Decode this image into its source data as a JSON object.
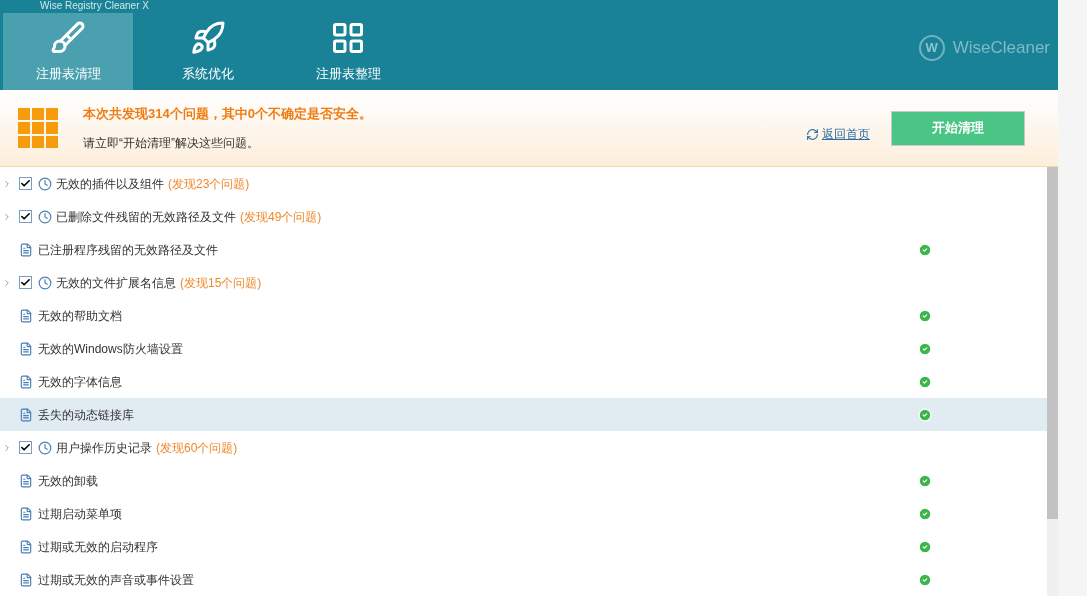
{
  "window": {
    "title": "Wise Registry Cleaner X"
  },
  "tabs": [
    {
      "label": "注册表清理",
      "kind": "broom",
      "selected": true
    },
    {
      "label": "系统优化",
      "kind": "rocket",
      "selected": false
    },
    {
      "label": "注册表整理",
      "kind": "blocks",
      "selected": false
    }
  ],
  "brand_mark": "W",
  "brand": "WiseCleaner",
  "summary": {
    "headline": "本次共发现314个问题，其中0个不确定是否安全。",
    "message": "请立即“开始清理”解决这些问题。",
    "link": "返回首页",
    "button": "开始清理"
  },
  "rows": [
    {
      "kind": "group",
      "label": "无效的插件以及组件",
      "count": "(发现23个问题)",
      "checked": true,
      "selected": false
    },
    {
      "kind": "group",
      "label": "已删除文件残留的无效路径及文件",
      "count": "(发现49个问题)",
      "checked": true,
      "selected": false
    },
    {
      "kind": "item",
      "label": "已注册程序残留的无效路径及文件",
      "selected": false
    },
    {
      "kind": "group",
      "label": "无效的文件扩展名信息",
      "count": "(发现15个问题)",
      "checked": true,
      "selected": false
    },
    {
      "kind": "item",
      "label": "无效的帮助文档",
      "selected": false
    },
    {
      "kind": "item",
      "label": "无效的Windows防火墙设置",
      "selected": false
    },
    {
      "kind": "item",
      "label": "无效的字体信息",
      "selected": false
    },
    {
      "kind": "item",
      "label": "丢失的动态链接库",
      "selected": true
    },
    {
      "kind": "group",
      "label": "用户操作历史记录",
      "count": "(发现60个问题)",
      "checked": true,
      "selected": false
    },
    {
      "kind": "item",
      "label": "无效的卸载",
      "selected": false
    },
    {
      "kind": "item",
      "label": "过期启动菜单项",
      "selected": false
    },
    {
      "kind": "item",
      "label": "过期或无效的启动程序",
      "selected": false
    },
    {
      "kind": "item",
      "label": "过期或无效的声音或事件设置",
      "selected": false
    }
  ]
}
